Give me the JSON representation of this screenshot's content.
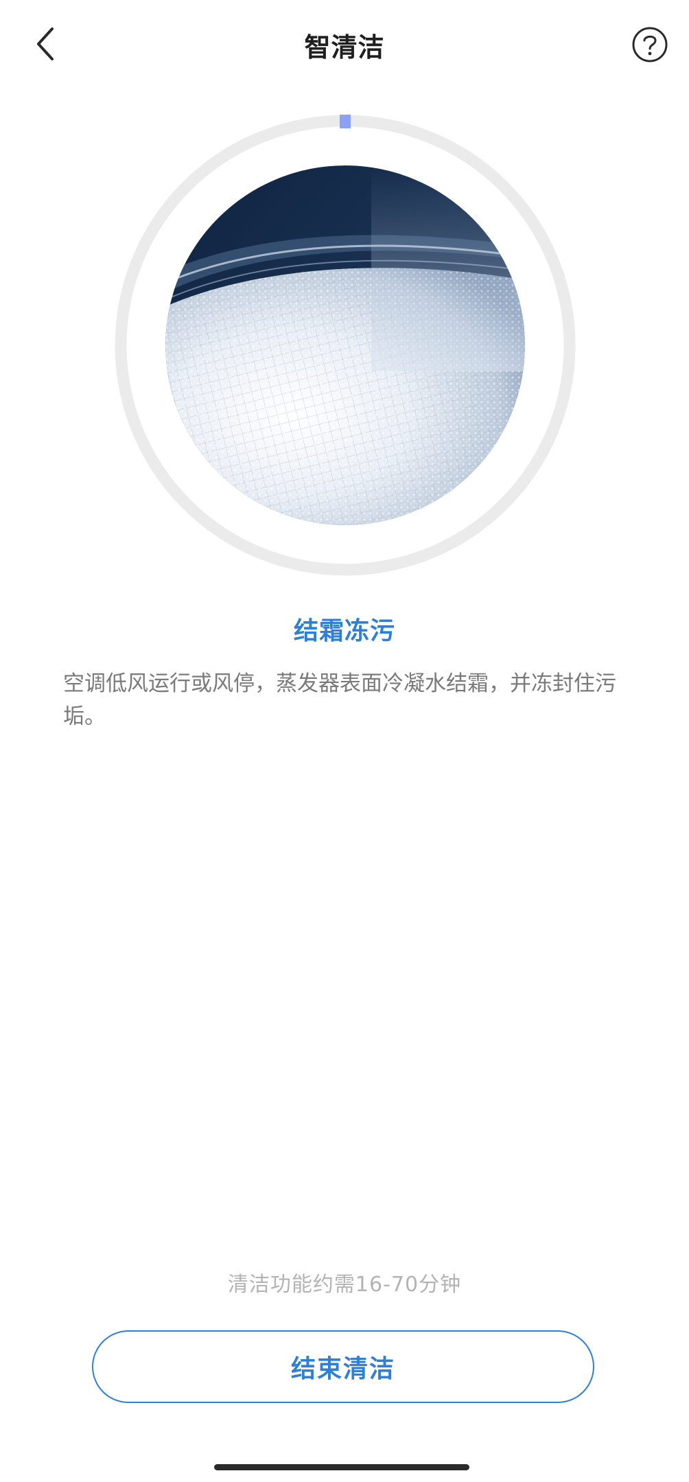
{
  "header": {
    "title": "智清洁",
    "back_icon": "chevron-left-icon",
    "help_icon": "question-circle-icon"
  },
  "progress": {
    "value": 0.01,
    "track_color": "#ebebeb",
    "indicator_color": "#8ba1f5"
  },
  "stage": {
    "image_icon": "frosted-evaporator-image",
    "title": "结霜冻污",
    "description": "空调低风运行或风停，蒸发器表面冷凝水结霜，并冻封住污垢。"
  },
  "footer": {
    "duration_note": "清洁功能约需16-70分钟",
    "end_button_label": "结束清洁"
  },
  "colors": {
    "accent": "#2d7fd7",
    "title": "#1f1f1f",
    "body_text": "#7a7a7a",
    "muted_text": "#b3b3b3"
  }
}
